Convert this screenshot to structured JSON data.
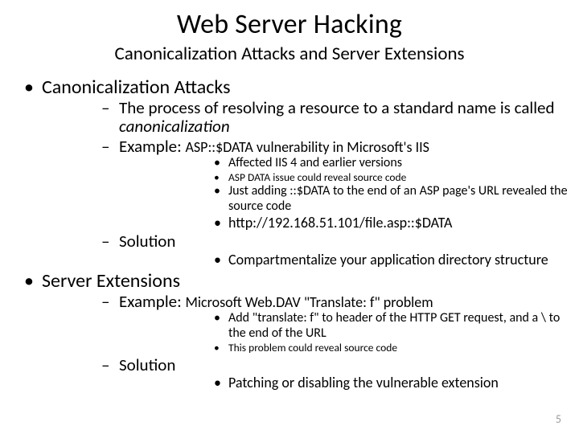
{
  "title": "Web Server Hacking",
  "subtitle": "Canonicalization Attacks and Server Extensions",
  "l1_a": "Canonicalization Attacks",
  "l2_a1_pre": "The process of resolving a resource to a standard name is called ",
  "l2_a1_ital": "canonicalization",
  "l2_a2_pre": "Example: ",
  "l2_a2_small": "ASP::$DATA vulnerability in Microsoft's IIS",
  "l3_a2_1": "Affected IIS 4 and earlier versions",
  "l3_a2_2": "ASP DATA issue could reveal source code",
  "l3_a2_3": "Just adding ::$DATA to the end of an ASP page's URL revealed the source code",
  "l3_a2_4": "http://192.168.51.101/file.asp::$DATA",
  "l2_a3": "Solution",
  "l3_a3_1": "Compartmentalize your application directory structure",
  "l1_b": "Server Extensions",
  "l2_b1_pre": "Example: ",
  "l2_b1_small": "Microsoft Web.DAV \"Translate: f\" problem",
  "l3_b1_1": "Add \"translate: f\" to header of the HTTP GET request, and a \\ to the end of the URL",
  "l3_b1_2": "This problem could reveal source code",
  "l2_b2": "Solution",
  "l3_b2_1": "Patching or disabling the vulnerable extension",
  "page_number": "5"
}
